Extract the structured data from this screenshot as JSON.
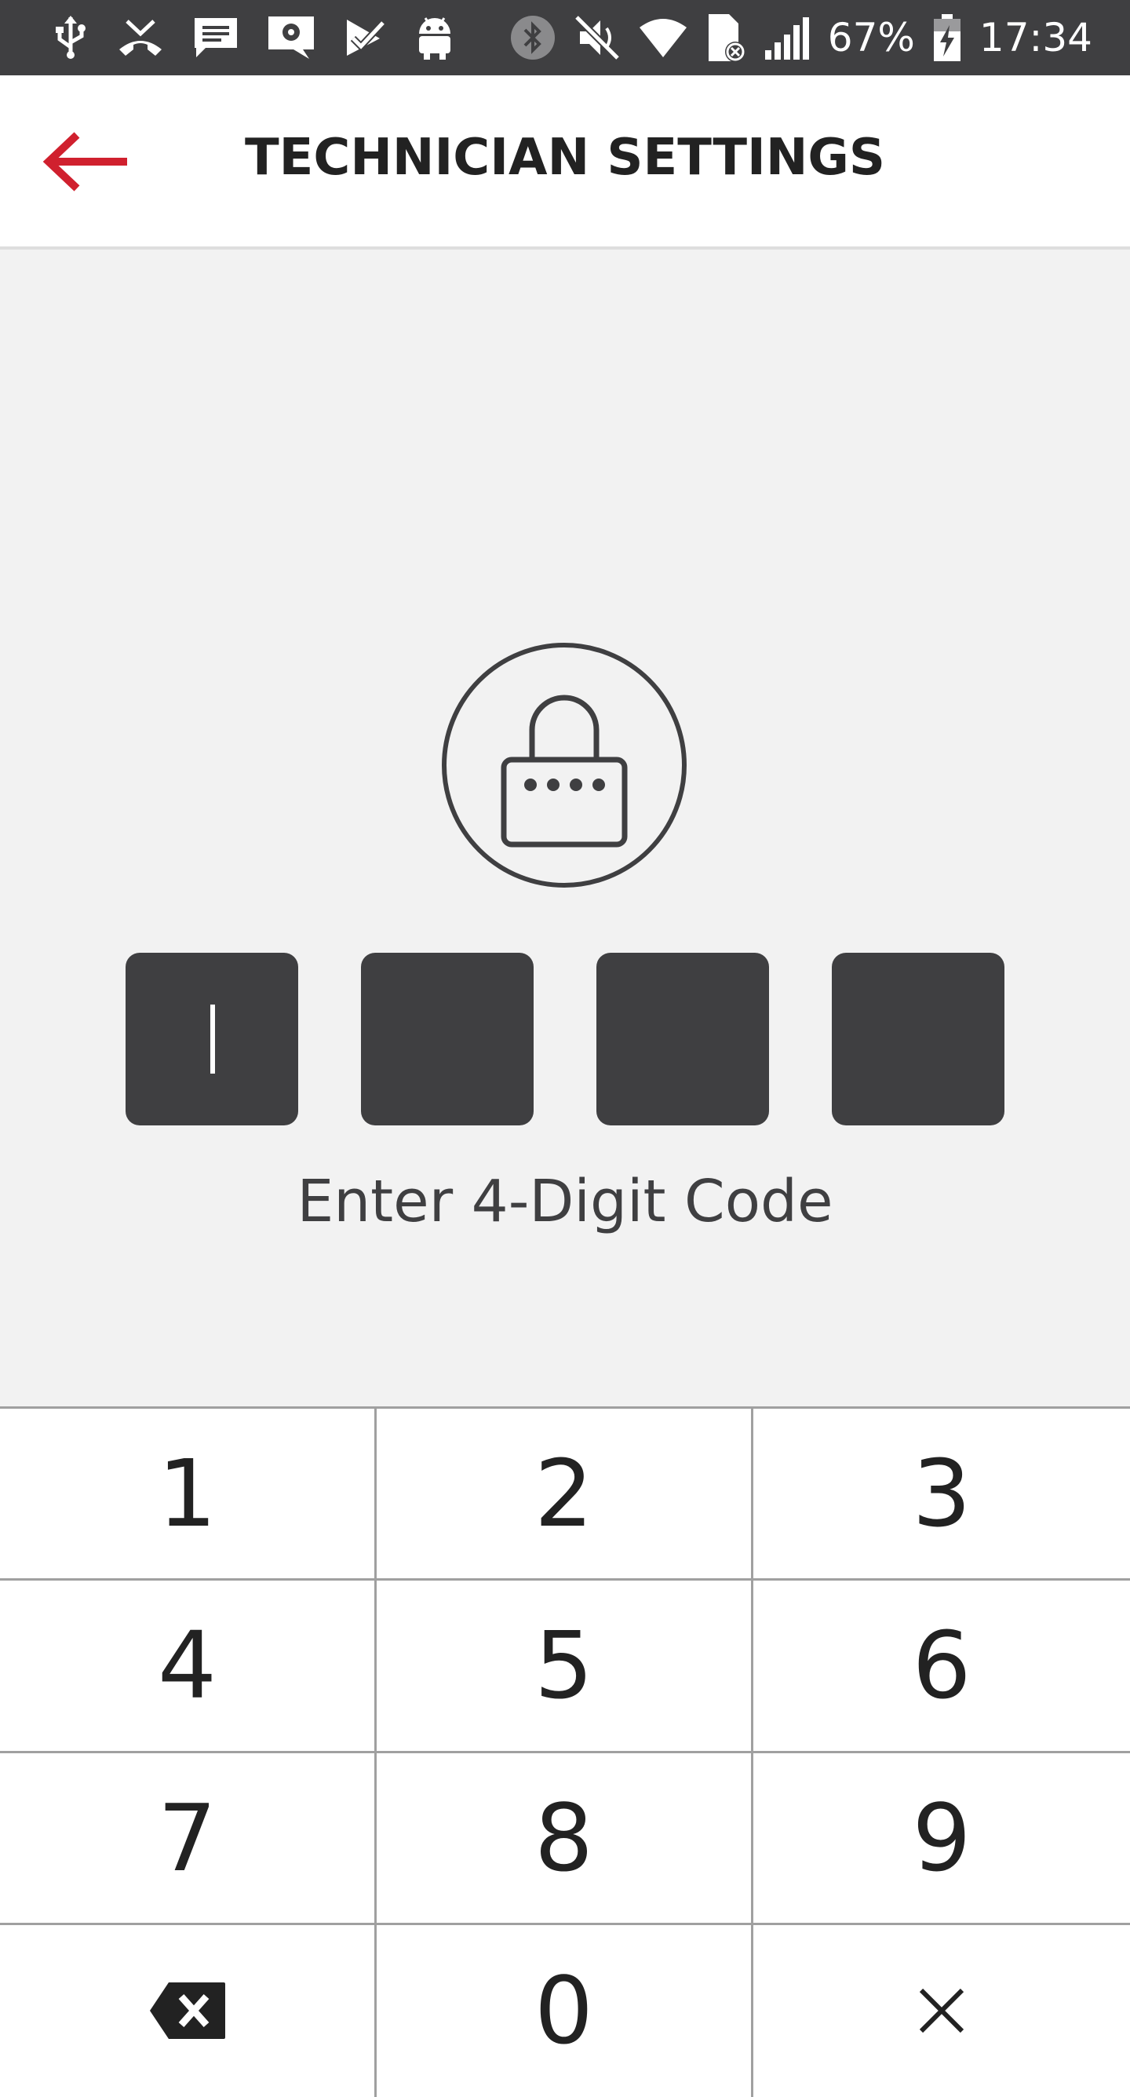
{
  "status_bar": {
    "icons": [
      "usb-icon",
      "missed-call-icon",
      "message-icon",
      "settings-message-icon",
      "check-icon",
      "android-icon",
      "bluetooth-icon",
      "mute-icon",
      "wifi-icon",
      "sim-error-icon",
      "signal-icon",
      "battery-charging-icon"
    ],
    "battery": "67%",
    "time": "17:34"
  },
  "header": {
    "back_icon": "arrow-left-icon",
    "title": "TECHNICIAN SETTINGS"
  },
  "lock": {
    "icon": "lock-icon"
  },
  "pin": {
    "length": 4,
    "entered": 0,
    "prompt": "Enter 4-Digit Code"
  },
  "keypad": {
    "keys": [
      "1",
      "2",
      "3",
      "4",
      "5",
      "6",
      "7",
      "8",
      "9"
    ],
    "zero": "0",
    "backspace_icon": "backspace-icon",
    "clear_icon": "close-icon"
  },
  "colors": {
    "accent": "#d0202e",
    "dark": "#3f3f41",
    "background": "#f2f2f2",
    "keypad_border": "#a0a0a0"
  }
}
